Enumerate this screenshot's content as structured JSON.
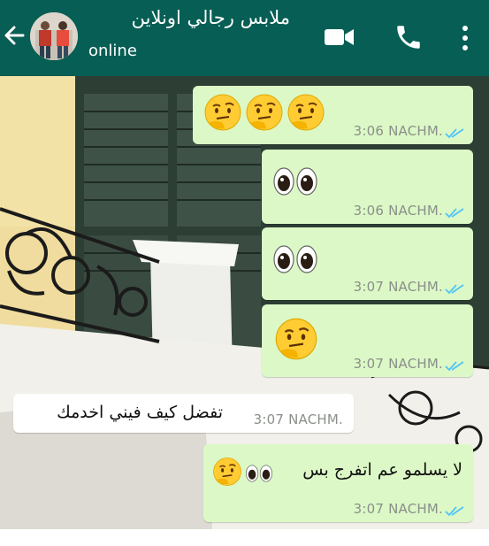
{
  "header": {
    "contact_name": "ملابس رجالي اونلاين",
    "status": "online",
    "back_icon": "arrow-left-icon",
    "video_icon": "video-camera-icon",
    "call_icon": "phone-icon",
    "menu_icon": "more-vert-icon",
    "bg_color": "#075e54"
  },
  "messages": [
    {
      "direction": "outgoing",
      "emoji": [
        "thinking-face",
        "thinking-face",
        "thinking-face"
      ],
      "time": "3:06 NACHM.",
      "ticks": "double-check-read-icon"
    },
    {
      "direction": "outgoing",
      "emoji": [
        "eyes"
      ],
      "time": "3:06 NACHM.",
      "ticks": "double-check-read-icon"
    },
    {
      "direction": "outgoing",
      "emoji": [
        "eyes"
      ],
      "time": "3:07 NACHM.",
      "ticks": "double-check-read-icon"
    },
    {
      "direction": "outgoing",
      "emoji": [
        "thinking-face"
      ],
      "time": "3:07 NACHM.",
      "ticks": "double-check-read-icon"
    },
    {
      "direction": "incoming",
      "text": "تفضل كيف فيني اخدمك",
      "time": "3:07 NACHM."
    },
    {
      "direction": "outgoing",
      "text": "لا يسلمو عم اتفرج بس",
      "emoji": [
        "eyes",
        "thinking-face"
      ],
      "time": "3:07 NACHM.",
      "ticks": "double-check-read-icon"
    }
  ],
  "colors": {
    "outgoing_bubble": "#dcf8c6",
    "incoming_bubble": "#ffffff",
    "read_ticks": "#4fc3f7"
  }
}
